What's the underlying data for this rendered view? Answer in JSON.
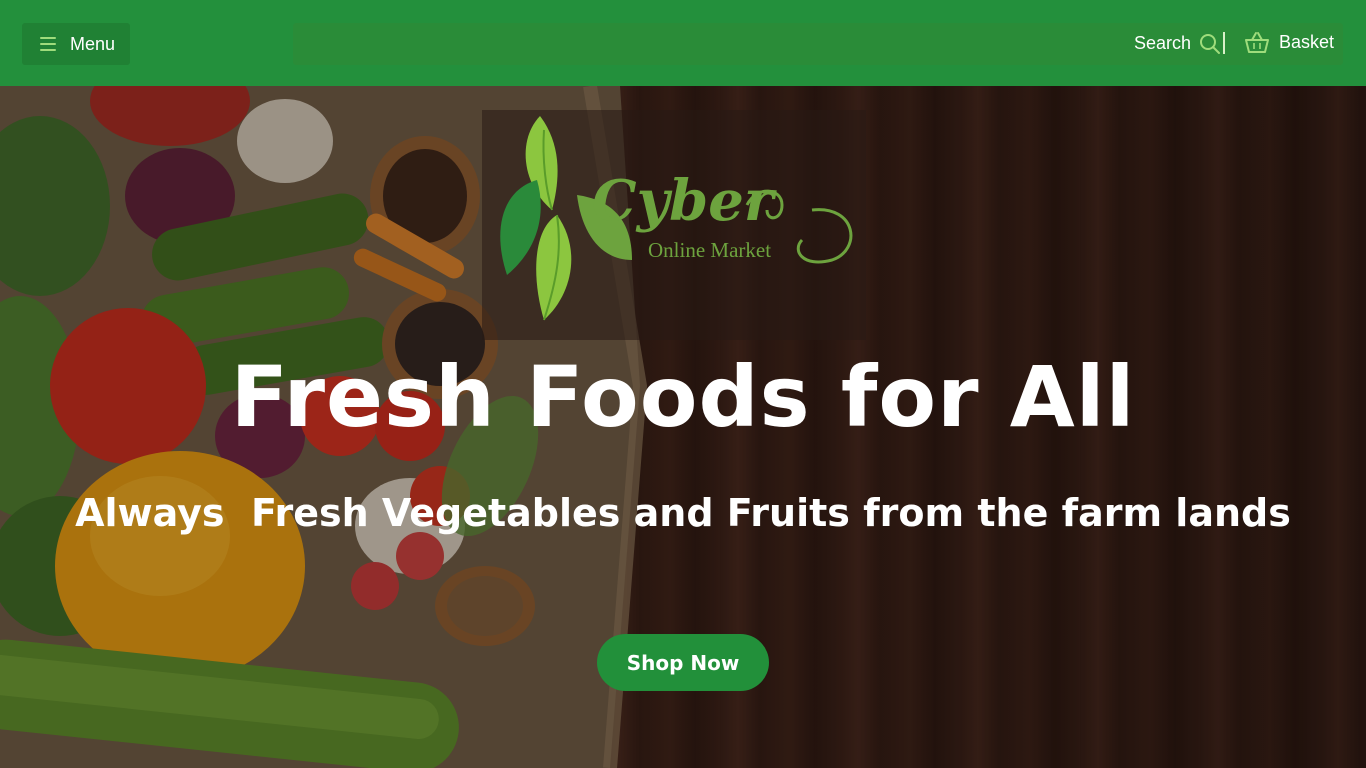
{
  "header": {
    "menu_label": "Menu",
    "search_label": "Search",
    "basket_label": "Basket",
    "icons": [
      "hamburger-icon",
      "search-icon",
      "basket-icon"
    ]
  },
  "logo": {
    "brand": "Cyber",
    "subtitle": "Online Market"
  },
  "hero": {
    "headline": "Fresh Foods for All",
    "subline": "Always  Fresh Vegetables and Fruits from the farm lands",
    "cta_label": "Shop Now"
  },
  "colors": {
    "brand_green": "#23903c",
    "logo_green": "#6da33e",
    "wood_dark": "#3a2118"
  }
}
